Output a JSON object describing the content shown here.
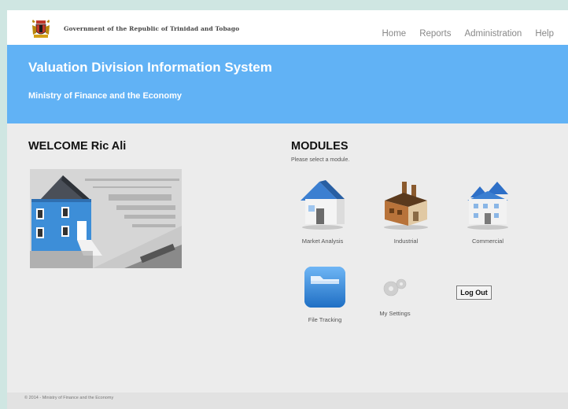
{
  "header": {
    "government_name": "Government of the Republic of Trinidad and Tobago",
    "nav": [
      "Home",
      "Reports",
      "Administration",
      "Help"
    ]
  },
  "banner": {
    "title": "Valuation Division Information System",
    "subtitle": "Ministry of Finance and the Economy"
  },
  "welcome": {
    "text": "WELCOME Ric Ali"
  },
  "modules": {
    "title": "MODULES",
    "subtitle": "Please select a module.",
    "items": [
      {
        "label": "Market Analysis",
        "icon": "house-icon"
      },
      {
        "label": "Industrial",
        "icon": "factory-icon"
      },
      {
        "label": "Commercial",
        "icon": "building-icon"
      },
      {
        "label": "File Tracking",
        "icon": "folder-icon"
      },
      {
        "label": "My Settings",
        "icon": "gear-icon"
      }
    ],
    "logout_label": "Log Out"
  },
  "footer": {
    "text": "© 2014 - Ministry of Finance and the Economy"
  },
  "colors": {
    "banner": "#61b2f5",
    "background": "#ececec"
  }
}
